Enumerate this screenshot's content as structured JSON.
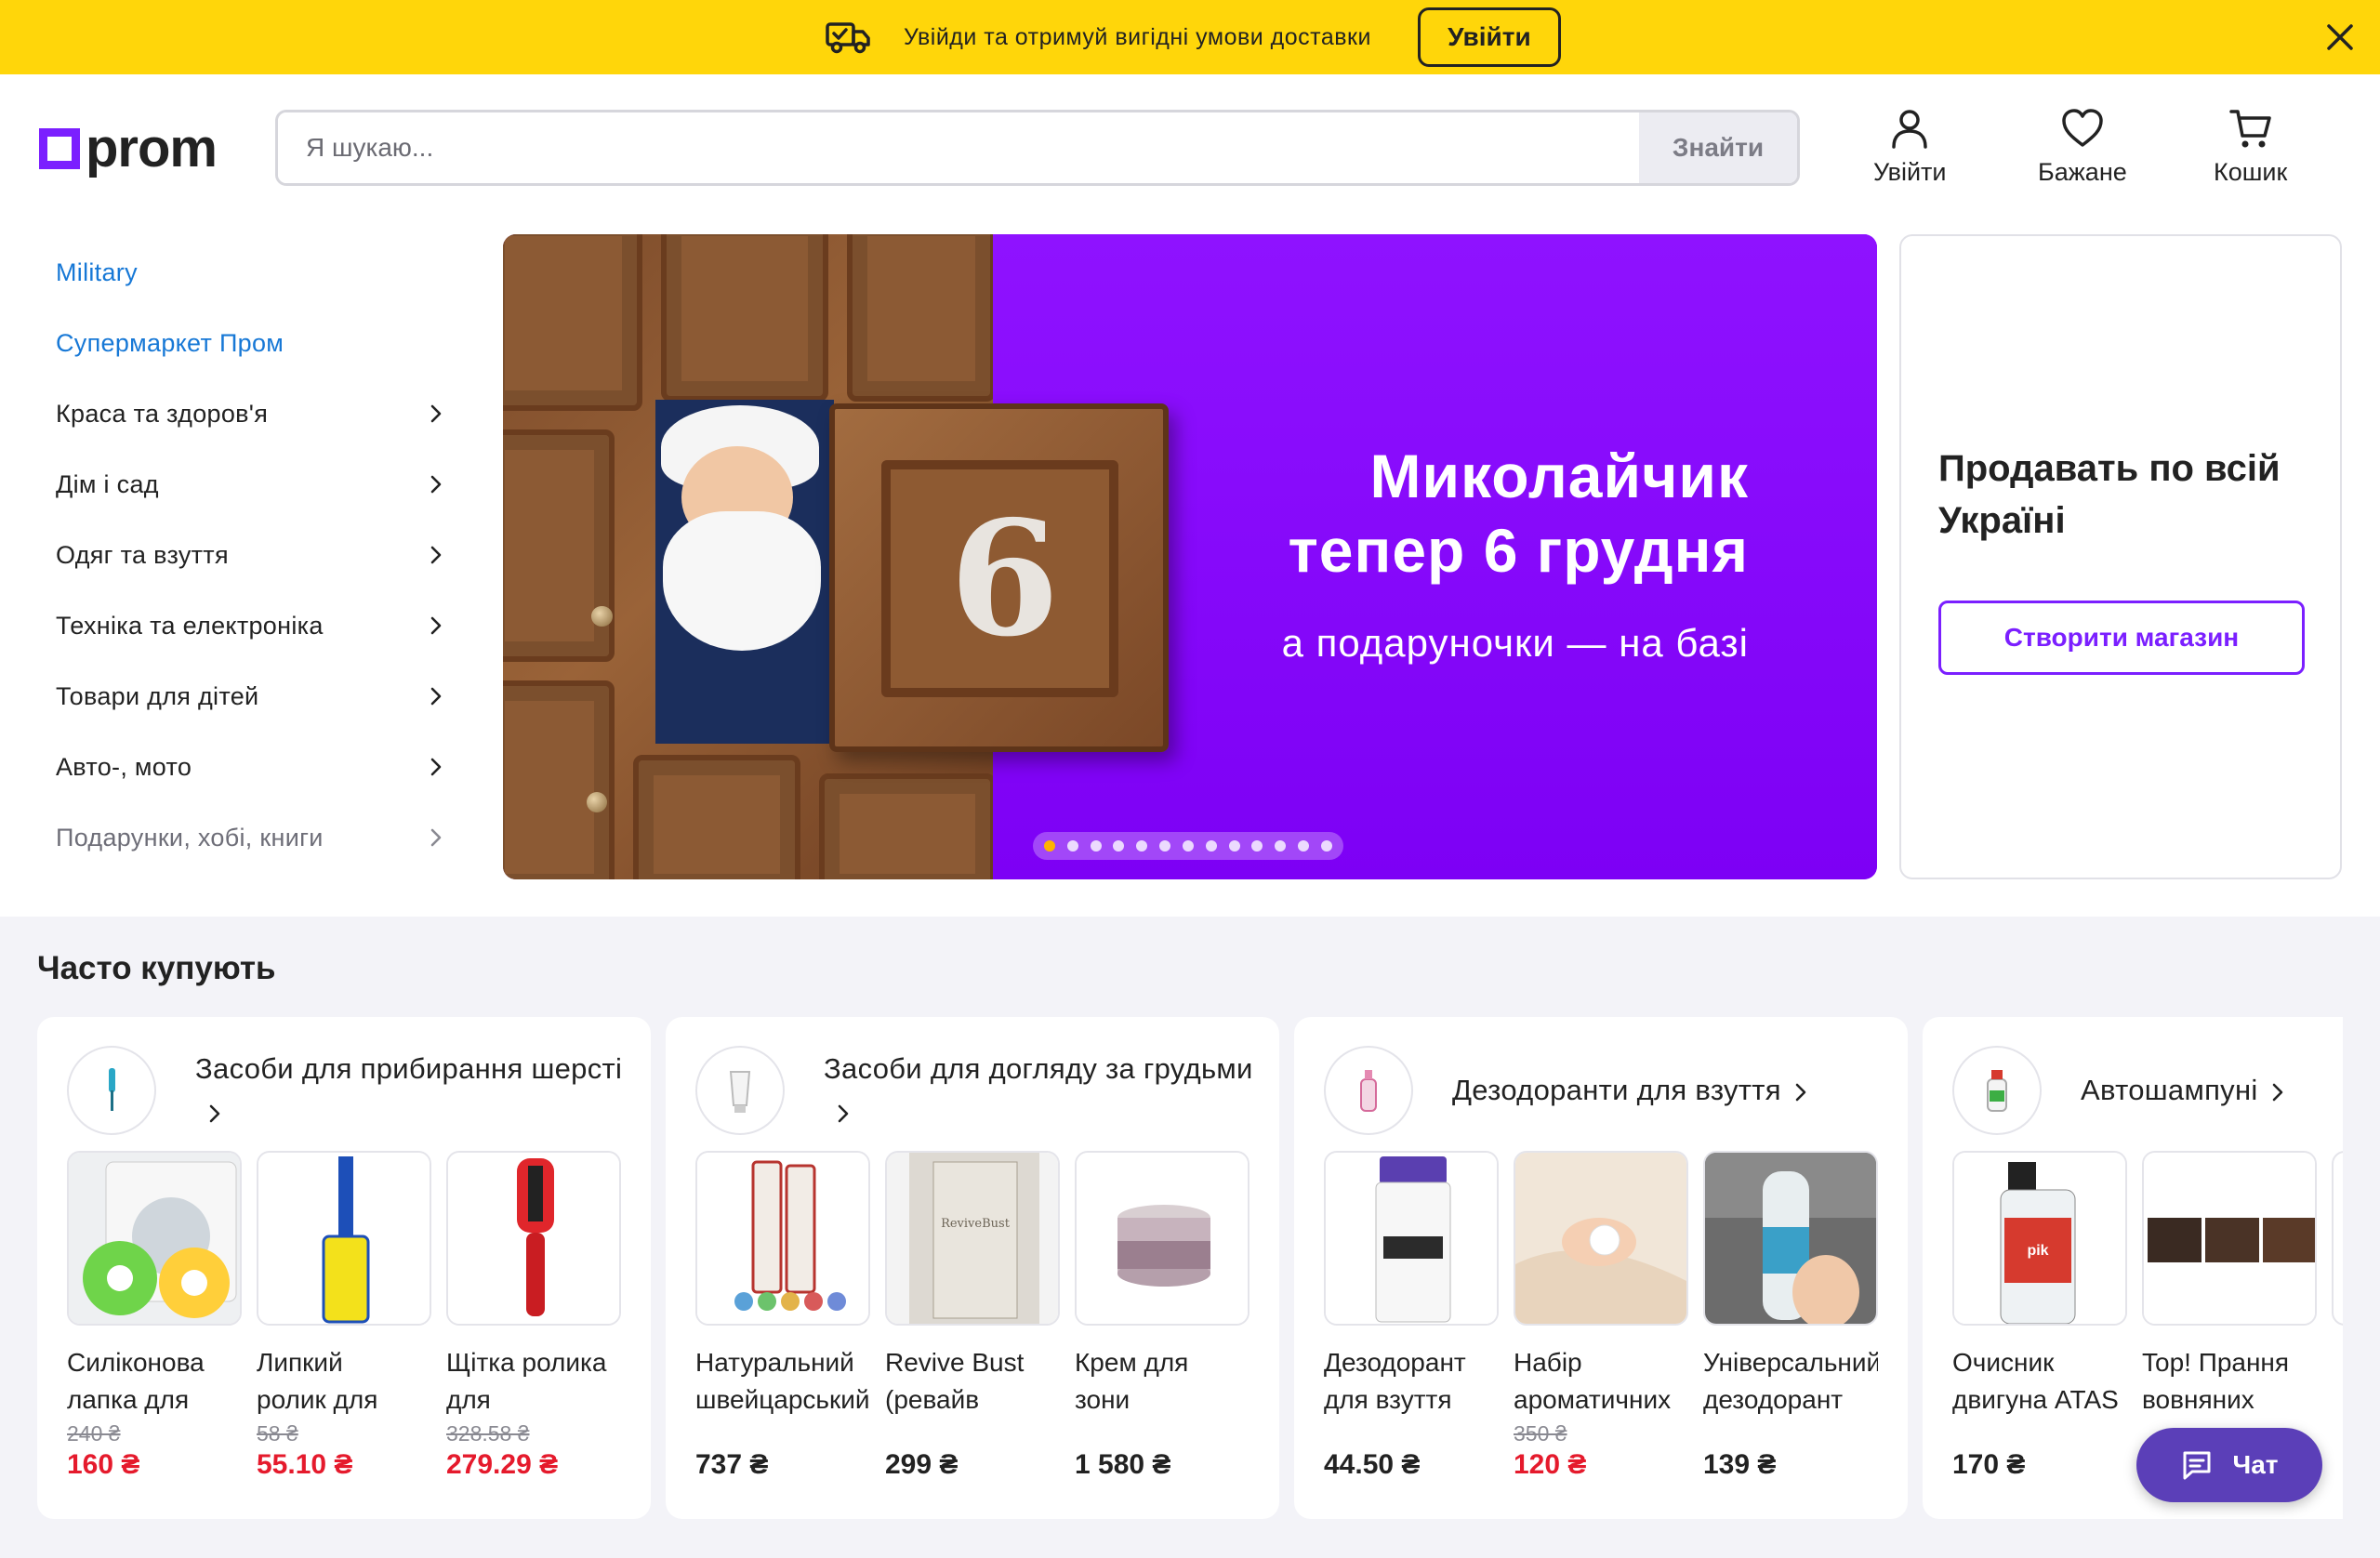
{
  "topbar": {
    "message": "Увійди та отримуй вигідні умови доставки",
    "login_label": "Увійти",
    "icons": [
      "delivery-truck-icon",
      "close-icon"
    ]
  },
  "header": {
    "logo_text": "prom",
    "search": {
      "placeholder": "Я шукаю...",
      "value": "",
      "button_label": "Знайти"
    },
    "actions": [
      {
        "label": "Увійти",
        "icon": "user-icon"
      },
      {
        "label": "Бажане",
        "icon": "heart-icon"
      },
      {
        "label": "Кошик",
        "icon": "cart-icon"
      }
    ]
  },
  "categories": [
    {
      "label": "Military",
      "style": "blue",
      "has_arrow": false
    },
    {
      "label": "Супермаркет Пром",
      "style": "blue",
      "has_arrow": false
    },
    {
      "label": "Краса та здоров'я",
      "style": "normal",
      "has_arrow": true
    },
    {
      "label": "Дім і сад",
      "style": "normal",
      "has_arrow": true
    },
    {
      "label": "Одяг та взуття",
      "style": "normal",
      "has_arrow": true
    },
    {
      "label": "Техніка та електроніка",
      "style": "normal",
      "has_arrow": true
    },
    {
      "label": "Товари для дітей",
      "style": "normal",
      "has_arrow": true
    },
    {
      "label": "Авто-, мото",
      "style": "normal",
      "has_arrow": true
    },
    {
      "label": "Подарунки, хобі, книги",
      "style": "gray",
      "has_arrow": true
    }
  ],
  "hero": {
    "title_line1": "Миколайчик",
    "title_line2": "тепер 6 грудня",
    "subtitle": "а подаруночки — на базі",
    "door_number": "6",
    "slide_count": 13,
    "active_slide": 1
  },
  "sell": {
    "title": "Продавать по всій Україні",
    "button_label": "Створити магазин"
  },
  "often_bought": {
    "title": "Часто купують",
    "cards": [
      {
        "title": "Засоби для прибирання шерсті",
        "icon": "lint-roller-icon",
        "products": [
          {
            "name_line1": "Силіконова",
            "name_line2": "лапка для",
            "old_price": "240 ₴",
            "price": "160 ₴",
            "image": "silicone-paw-image"
          },
          {
            "name_line1": "Липкий",
            "name_line2": "ролик для",
            "old_price": "58 ₴",
            "price": "55.10 ₴",
            "image": "lint-roller-image"
          },
          {
            "name_line1": "Щітка ролика",
            "name_line2": "для",
            "old_price": "328.58 ₴",
            "price": "279.29 ₴",
            "image": "brush-roller-image"
          }
        ]
      },
      {
        "title": "Засоби для догляду за грудьми",
        "icon": "cream-tube-icon",
        "products": [
          {
            "name_line1": "Натуральний",
            "name_line2": "швейцарський",
            "old_price": "",
            "price": "737 ₴",
            "image": "cream-tubes-image"
          },
          {
            "name_line1": "Revive Bust",
            "name_line2": "(ревайв",
            "old_price": "",
            "price": "299 ₴",
            "image": "revive-bust-image"
          },
          {
            "name_line1": "Крем для",
            "name_line2": "зони",
            "old_price": "",
            "price": "1 580 ₴",
            "image": "cream-jar-image"
          }
        ]
      },
      {
        "title": "Дезодоранти для взуття",
        "icon": "spray-bottle-icon",
        "products": [
          {
            "name_line1": "Дезодорант",
            "name_line2": "для взуття",
            "old_price": "",
            "price": "44.50 ₴",
            "image": "shoe-deodorant-image"
          },
          {
            "name_line1": "Набір",
            "name_line2": "ароматичних",
            "old_price": "350 ₴",
            "price": "120 ₴",
            "image": "aroma-balls-image"
          },
          {
            "name_line1": "Універсальний",
            "name_line2": "дезодорант",
            "old_price": "",
            "price": "139 ₴",
            "image": "spray-can-image"
          }
        ]
      },
      {
        "title": "Автошампуні",
        "icon": "car-shampoo-icon",
        "products": [
          {
            "name_line1": "Очисник",
            "name_line2": "двигуна ATAS",
            "old_price": "",
            "price": "170 ₴",
            "image": "engine-cleaner-image"
          },
          {
            "name_line1": "Top! Прання",
            "name_line2": "вовняних",
            "old_price": "",
            "price": "",
            "image": "wool-washing-image"
          },
          {
            "name_line1": "",
            "name_line2": "",
            "old_price": "",
            "price": "",
            "image": "partial-product-image"
          }
        ]
      }
    ]
  },
  "chat": {
    "label": "Чат",
    "icon": "chat-icon"
  },
  "colors": {
    "topbar_bg": "#ffd60a",
    "brand_purple": "#7b1fff",
    "hero_purple": "#8a0bff",
    "link_blue": "#1778d6",
    "sale_red": "#e51a2c",
    "chat_purple": "#5b3fb8",
    "slider_active": "#ffb300"
  }
}
